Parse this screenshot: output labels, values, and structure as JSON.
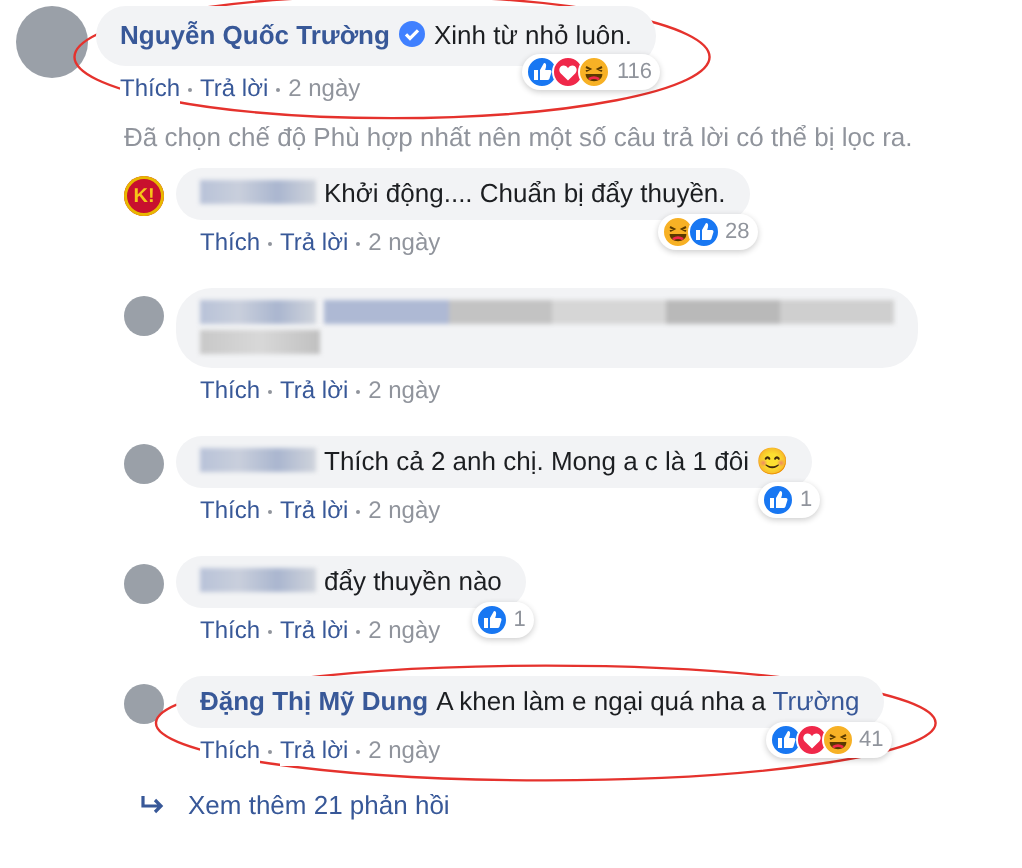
{
  "comment": {
    "author": "Nguyễn Quốc Trường",
    "verified": true,
    "text": "Xinh từ nhỏ luôn.",
    "highlighted": true,
    "actions": [
      "Thích",
      "Trả lời"
    ],
    "time": "2 ngày",
    "reactions": {
      "icons": [
        {
          "kind": "like"
        },
        {
          "kind": "love"
        },
        {
          "kind": "haha"
        }
      ],
      "count": "116"
    }
  },
  "filter_notice": "Đã chọn chế độ Phù hợp nhất nên một số câu trả lời có thể bị lọc ra.",
  "replies": [
    {
      "avatar": {
        "kind": "logo",
        "text": "K!"
      },
      "name_blurred": true,
      "text": "Khởi động.... Chuẩn bị đẩy thuyền.",
      "highlighted": false,
      "actions": [
        "Thích",
        "Trả lời"
      ],
      "time": "2 ngày",
      "reactions": {
        "icons": [
          {
            "kind": "haha"
          },
          {
            "kind": "like"
          }
        ],
        "count": "28"
      }
    },
    {
      "avatar": {
        "kind": "photo"
      },
      "name_blurred": true,
      "text_blurred": true,
      "highlighted": false,
      "actions": [
        "Thích",
        "Trả lời"
      ],
      "time": "2 ngày"
    },
    {
      "avatar": {
        "kind": "photo"
      },
      "name_blurred": true,
      "text": "Thích cả 2 anh chị. Mong a c là 1 đôi",
      "emoji": "😊",
      "highlighted": false,
      "actions": [
        "Thích",
        "Trả lời"
      ],
      "time": "2 ngày",
      "reactions": {
        "icons": [
          {
            "kind": "like"
          }
        ],
        "count": "1"
      }
    },
    {
      "avatar": {
        "kind": "photo"
      },
      "name_blurred": true,
      "text": "đẩy thuyền nào",
      "highlighted": false,
      "actions": [
        "Thích",
        "Trả lời"
      ],
      "time": "2 ngày",
      "reactions": {
        "icons": [
          {
            "kind": "like"
          }
        ],
        "count": "1"
      }
    },
    {
      "avatar": {
        "kind": "photo"
      },
      "author": "Đặng Thị Mỹ Dung",
      "name_blurred": false,
      "text": "A khen làm e ngại quá nha a",
      "mention": "Trường",
      "highlighted": true,
      "actions": [
        "Thích",
        "Trả lời"
      ],
      "time": "2 ngày",
      "reactions": {
        "icons": [
          {
            "kind": "like"
          },
          {
            "kind": "love"
          },
          {
            "kind": "haha"
          }
        ],
        "count": "41"
      }
    }
  ],
  "more_replies": "Xem thêm 21 phản hồi"
}
